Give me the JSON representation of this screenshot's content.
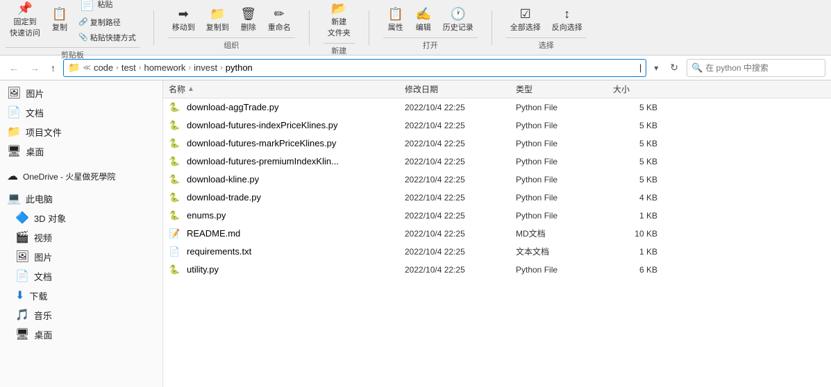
{
  "toolbar": {
    "groups": [
      {
        "label": "剪贴板",
        "buttons_top": [
          {
            "id": "pin",
            "icon": "📌",
            "label": "固定到\n快速访问"
          },
          {
            "id": "copy",
            "icon": "📋",
            "label": "复制"
          },
          {
            "id": "paste",
            "icon": "📄",
            "label": "粘贴"
          }
        ],
        "buttons_sub": [
          {
            "id": "copy-path",
            "icon": "🔗",
            "label": "复制路径"
          },
          {
            "id": "paste-shortcut",
            "icon": "📎",
            "label": "粘贴快捷方式"
          }
        ]
      },
      {
        "label": "组织",
        "buttons": [
          {
            "id": "move-to",
            "icon": "➡",
            "label": "移动到"
          },
          {
            "id": "copy-to",
            "icon": "📁",
            "label": "复制到"
          },
          {
            "id": "delete",
            "icon": "🗑",
            "label": "删除"
          },
          {
            "id": "rename",
            "icon": "✏",
            "label": "重命名"
          }
        ]
      },
      {
        "label": "新建",
        "buttons": [
          {
            "id": "new-folder",
            "icon": "📂",
            "label": "新建\n文件夹"
          }
        ]
      },
      {
        "label": "打开",
        "buttons": [
          {
            "id": "properties",
            "icon": "📋",
            "label": "属性"
          },
          {
            "id": "open",
            "icon": "📂",
            "label": "编辑"
          },
          {
            "id": "history",
            "icon": "🕐",
            "label": "历史记录"
          }
        ]
      },
      {
        "label": "选择",
        "buttons": [
          {
            "id": "select-all",
            "icon": "☑",
            "label": "全部选择"
          },
          {
            "id": "invert",
            "icon": "↕",
            "label": "反向选择"
          }
        ]
      }
    ]
  },
  "addressbar": {
    "nav": {
      "back_label": "←",
      "forward_label": "→",
      "up_label": "↑"
    },
    "breadcrumb": [
      {
        "label": "code",
        "active": false
      },
      {
        "label": "test",
        "active": false
      },
      {
        "label": "homework",
        "active": false
      },
      {
        "label": "invest",
        "active": false
      },
      {
        "label": "python",
        "active": true
      }
    ],
    "search_placeholder": "在 python 中搜索"
  },
  "sidebar": {
    "items": [
      {
        "id": "pictures",
        "icon": "🖼",
        "label": "图片"
      },
      {
        "id": "docs",
        "icon": "📄",
        "label": "文档"
      },
      {
        "id": "project",
        "icon": "📁",
        "label": "项目文件"
      },
      {
        "id": "desktop",
        "icon": "🖥",
        "label": "桌面"
      },
      {
        "id": "onedrive",
        "icon": "☁",
        "label": "OneDrive - 火星做死學院"
      },
      {
        "id": "thispc",
        "icon": "💻",
        "label": "此电脑"
      },
      {
        "id": "3dobj",
        "icon": "🔷",
        "label": "3D 对象"
      },
      {
        "id": "video",
        "icon": "🎬",
        "label": "视频"
      },
      {
        "id": "pictures2",
        "icon": "🖼",
        "label": "图片"
      },
      {
        "id": "docs2",
        "icon": "📄",
        "label": "文档"
      },
      {
        "id": "download",
        "icon": "⬇",
        "label": "下载"
      },
      {
        "id": "music",
        "icon": "🎵",
        "label": "音乐"
      },
      {
        "id": "desktop2",
        "icon": "🖥",
        "label": "桌面"
      }
    ]
  },
  "filelist": {
    "columns": {
      "name": "名称",
      "date": "修改日期",
      "type": "类型",
      "size": "大小"
    },
    "files": [
      {
        "name": "download-aggTrade.py",
        "date": "2022/10/4 22:25",
        "type": "Python File",
        "size": "5 KB",
        "icon": "py"
      },
      {
        "name": "download-futures-indexPriceKlines.py",
        "date": "2022/10/4 22:25",
        "type": "Python File",
        "size": "5 KB",
        "icon": "py"
      },
      {
        "name": "download-futures-markPriceKlines.py",
        "date": "2022/10/4 22:25",
        "type": "Python File",
        "size": "5 KB",
        "icon": "py"
      },
      {
        "name": "download-futures-premiumIndexKlin...",
        "date": "2022/10/4 22:25",
        "type": "Python File",
        "size": "5 KB",
        "icon": "py"
      },
      {
        "name": "download-kline.py",
        "date": "2022/10/4 22:25",
        "type": "Python File",
        "size": "5 KB",
        "icon": "py"
      },
      {
        "name": "download-trade.py",
        "date": "2022/10/4 22:25",
        "type": "Python File",
        "size": "4 KB",
        "icon": "py"
      },
      {
        "name": "enums.py",
        "date": "2022/10/4 22:25",
        "type": "Python File",
        "size": "1 KB",
        "icon": "py"
      },
      {
        "name": "README.md",
        "date": "2022/10/4 22:25",
        "type": "MD文档",
        "size": "10 KB",
        "icon": "md"
      },
      {
        "name": "requirements.txt",
        "date": "2022/10/4 22:25",
        "type": "文本文档",
        "size": "1 KB",
        "icon": "txt"
      },
      {
        "name": "utility.py",
        "date": "2022/10/4 22:25",
        "type": "Python File",
        "size": "6 KB",
        "icon": "py"
      }
    ]
  }
}
